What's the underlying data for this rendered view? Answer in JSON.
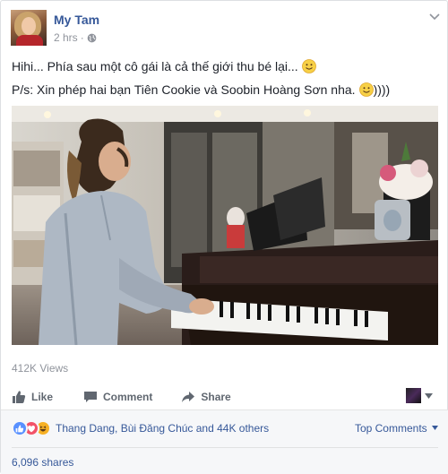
{
  "post": {
    "author": "My Tam",
    "time": "2 hrs",
    "separator": "·",
    "privacy_icon": "globe-icon",
    "text_line1": "Hihi... Phía sau một cô gái là cả thế giới thu bé lại...",
    "text_line2": "P/s: Xin phép hai bạn Tiên Cookie và Soobin Hoàng Sơn nha.",
    "text_line2_suffix": "))))",
    "views": "412K Views"
  },
  "actions": {
    "like": "Like",
    "comment": "Comment",
    "share": "Share"
  },
  "reactions": {
    "types": [
      "like",
      "love",
      "haha"
    ],
    "names": "Thang Dang, Bùi Đăng Chúc and 44K others",
    "top_comments": "Top Comments",
    "shares": "6,096 shares"
  },
  "colors": {
    "link": "#365899",
    "meta": "#90949c",
    "like": "#5890ff",
    "love": "#f25268",
    "haha": "#f7b125"
  }
}
